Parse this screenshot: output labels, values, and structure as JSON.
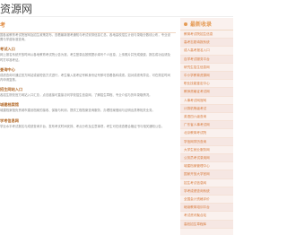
{
  "brand": {
    "text": "资源网"
  },
  "main": {
    "heading": "考",
    "blocks": [
      {
        "type": "para",
        "text": "国各省教育考试院官网及招生政策发布，查看最新报考通知与考试安排信息汇总。各地高校招生计划与录取分数线公布，专业设置与学费标准查询。"
      },
      {
        "type": "sec",
        "text": "考试入口"
      },
      {
        "type": "para",
        "text": "网上报名系统开放时间以各地教育考试院公告为准，考生登录后按照提示填写个人信息、上传照片并完成缴费，报名成功后请及时打印准考证。"
      },
      {
        "type": "sec",
        "text": "查询中心"
      },
      {
        "type": "para",
        "text": "成绩查询可通过官方网站或者短信方式进行，考生输入准考证号和身份证号即可查看各科成绩。如对成绩有异议，可在规定时间内申请复核。"
      },
      {
        "type": "sec",
        "text": "招生网站入口"
      },
      {
        "type": "para",
        "text": "各招生院校官方网站入口汇总，点击链接可直接访问学校招生信息网，了解招生章程、专业介绍与历年录取情况。"
      },
      {
        "type": "sec",
        "text": "城建档案馆"
      },
      {
        "type": "para",
        "text": "城建档案馆负责城市建设档案的接收、保管与利用，提供工程档案查询服务，办理档案借阅与证明出具等相关业务。"
      },
      {
        "type": "sec",
        "text": "学考信息网"
      },
      {
        "type": "para",
        "text": "学业水平考试报名与成绩查询平台，发布考试时间安排、考点分布及注意事项，考生可在线查看合格证书与相关通知公告。"
      }
    ]
  },
  "sidebar": {
    "title": "最新收录",
    "items": [
      "教育考试院招生信息",
      "高考志愿填报系统",
      "成人高考报名入口",
      "自学考试服务平台",
      "研究生招生信息网",
      "中小学教育资源网",
      "职业技能鉴定中心",
      "教师资格证考试网",
      "人事考试网官网",
      "计算机等级考试",
      "英语四六级查询",
      "广东省人事考试网",
      "北京教育考试院",
      "学信网学历查询",
      "大学生就业服务网",
      "公务员考试录用网",
      "城建档案管理中心",
      "国家开放大学官网",
      "招生考试信息网",
      "学考成绩查询系统",
      "全国会计资格评价",
      "继续教育培训平台",
      "考试资讯聚合站",
      "高校招生章程库"
    ]
  },
  "colors": {
    "accent": "#e59b55",
    "link": "#d77a3a",
    "sideBg": "#faf1ee"
  }
}
